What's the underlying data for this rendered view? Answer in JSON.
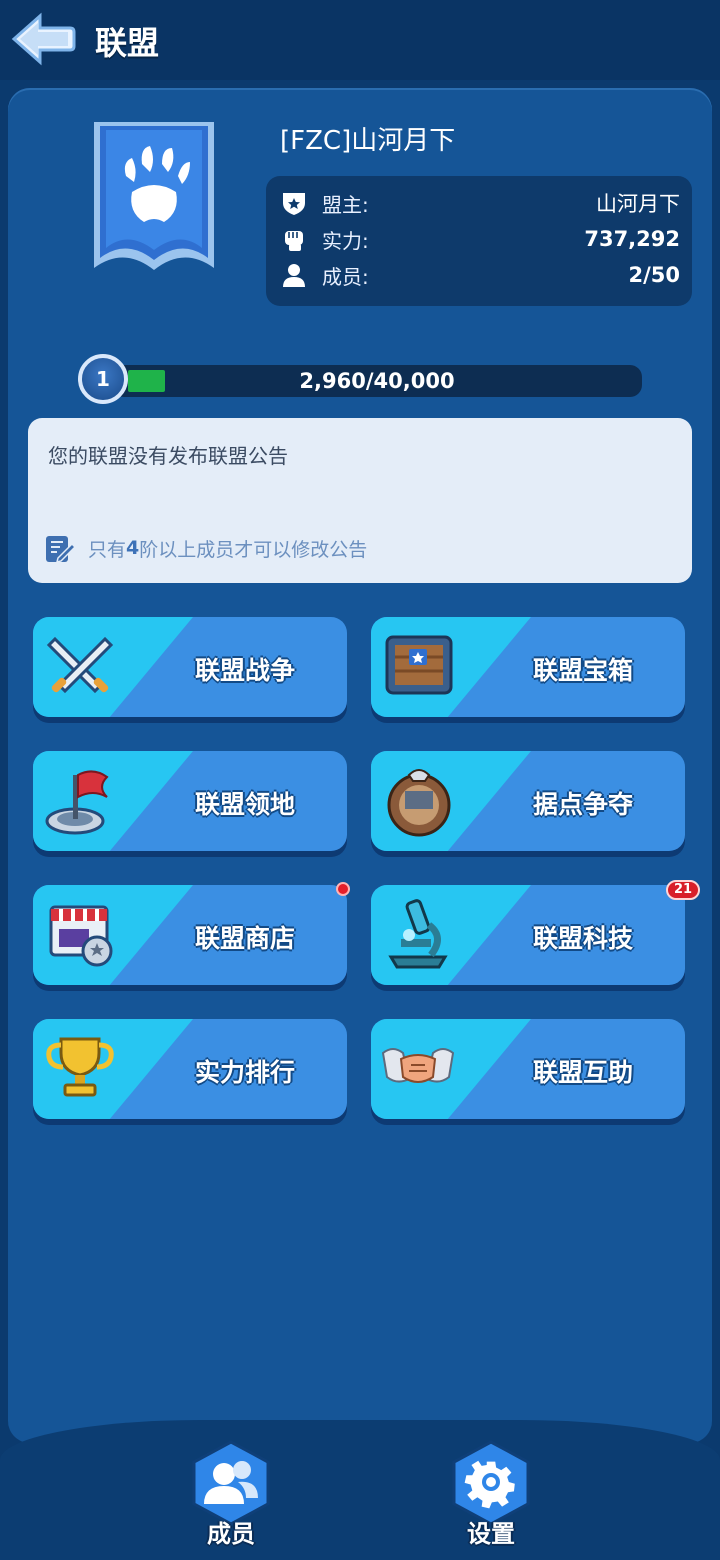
{
  "header": {
    "title": "联盟"
  },
  "alliance": {
    "name": "[FZC]山河月下",
    "info": [
      {
        "icon": "leader-shield-icon",
        "label": "盟主:",
        "value": "山河月下"
      },
      {
        "icon": "fist-icon",
        "label": "实力:",
        "value": "737,292"
      },
      {
        "icon": "member-icon",
        "label": "成员:",
        "value": "2/50"
      }
    ],
    "level": "1",
    "progress": {
      "text": "2,960/40,000",
      "fraction": 0.074
    }
  },
  "notice": {
    "text": "您的联盟没有发布联盟公告",
    "hint_before": "只有",
    "hint_num": "4",
    "hint_after": "阶以上成员才可以修改公告"
  },
  "menu": [
    {
      "label": "联盟战争",
      "icon": "crossed-swords-icon"
    },
    {
      "label": "联盟宝箱",
      "icon": "treasure-chest-icon"
    },
    {
      "label": "联盟领地",
      "icon": "flag-territory-icon"
    },
    {
      "label": "据点争夺",
      "icon": "stronghold-icon"
    },
    {
      "label": "联盟商店",
      "icon": "shop-icon",
      "badge_dot": true
    },
    {
      "label": "联盟科技",
      "icon": "microscope-icon",
      "badge": "21"
    },
    {
      "label": "实力排行",
      "icon": "trophy-icon"
    },
    {
      "label": "联盟互助",
      "icon": "handshake-icon"
    }
  ],
  "bottom_nav": [
    {
      "label": "成员",
      "icon": "members-icon"
    },
    {
      "label": "设置",
      "icon": "settings-gear-icon"
    }
  ],
  "colors": {
    "background": "#0b3a6e",
    "panel": "#155597",
    "button": "#3b8fe3",
    "button_accent": "#27c6f2"
  }
}
